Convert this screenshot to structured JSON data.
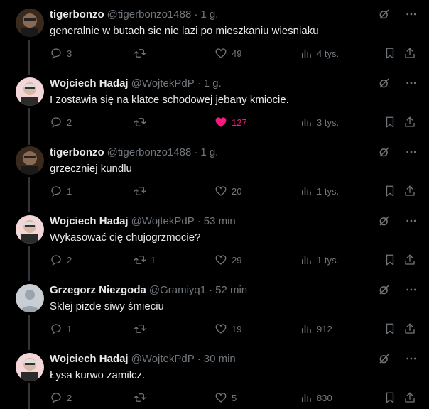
{
  "colors": {
    "background": "#000000",
    "text": "#e7e9ea",
    "muted": "#71767b",
    "like": "#f91880",
    "thread_line": "#333639"
  },
  "icons": {
    "grok": "slashed-circle-icon",
    "more": "more-dots-icon",
    "reply": "reply-bubble-icon",
    "retweet": "retweet-icon",
    "like": "heart-icon",
    "views": "bar-chart-icon",
    "bookmark": "bookmark-icon",
    "share": "share-icon"
  },
  "tweets": [
    {
      "name": "tigerbonzo",
      "handle": "@tigerbonzo1488",
      "dot": "·",
      "time": "1 g.",
      "text": "generalnie w butach sie nie lazi po mieszkaniu wiesniaku",
      "replies": "3",
      "retweets": "",
      "likes": "49",
      "liked": false,
      "views": "4 tys.",
      "avatar": "photo-dark"
    },
    {
      "name": "Wojciech Hadaj",
      "handle": "@WojtekPdP",
      "dot": "·",
      "time": "1 g.",
      "text": "I zostawia się na klatce schodowej jebany kmiocie.",
      "replies": "2",
      "retweets": "",
      "likes": "127",
      "liked": true,
      "views": "3 tys.",
      "avatar": "photo-light"
    },
    {
      "name": "tigerbonzo",
      "handle": "@tigerbonzo1488",
      "dot": "·",
      "time": "1 g.",
      "text": "grzeczniej kundlu",
      "replies": "1",
      "retweets": "",
      "likes": "20",
      "liked": false,
      "views": "1 tys.",
      "avatar": "photo-dark"
    },
    {
      "name": "Wojciech Hadaj",
      "handle": "@WojtekPdP",
      "dot": "·",
      "time": "53 min",
      "text": "Wykasować cię chujogrzmocie?",
      "replies": "2",
      "retweets": "1",
      "likes": "29",
      "liked": false,
      "views": "1 tys.",
      "avatar": "photo-light"
    },
    {
      "name": "Grzegorz Niezgoda",
      "handle": "@Gramiyq1",
      "dot": "·",
      "time": "52 min",
      "text": "Sklej pizde siwy śmieciu",
      "replies": "1",
      "retweets": "",
      "likes": "19",
      "liked": false,
      "views": "912",
      "avatar": "default"
    },
    {
      "name": "Wojciech Hadaj",
      "handle": "@WojtekPdP",
      "dot": "·",
      "time": "30 min",
      "text": "Łysa kurwo zamilcz.",
      "replies": "2",
      "retweets": "",
      "likes": "5",
      "liked": false,
      "views": "830",
      "avatar": "photo-light"
    }
  ]
}
